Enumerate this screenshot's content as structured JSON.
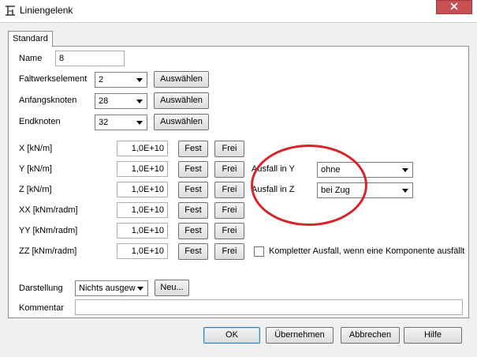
{
  "window": {
    "title": "Liniengelenk"
  },
  "tabs": [
    {
      "label": "Standard"
    }
  ],
  "fields": {
    "name": {
      "label": "Name",
      "value": "8"
    },
    "faltwerkselement": {
      "label": "Faltwerkselement",
      "value": "2",
      "button": "Auswählen"
    },
    "anfangsknoten": {
      "label": "Anfangsknoten",
      "value": "28",
      "button": "Auswählen"
    },
    "endknoten": {
      "label": "Endknoten",
      "value": "32",
      "button": "Auswählen"
    }
  },
  "springs": [
    {
      "label": "X [kN/m]",
      "value": "1,0E+10",
      "fest": "Fest",
      "frei": "Frei"
    },
    {
      "label": "Y [kN/m]",
      "value": "1,0E+10",
      "fest": "Fest",
      "frei": "Frei"
    },
    {
      "label": "Z [kN/m]",
      "value": "1,0E+10",
      "fest": "Fest",
      "frei": "Frei"
    },
    {
      "label": "XX [kNm/radm]",
      "value": "1,0E+10",
      "fest": "Fest",
      "frei": "Frei"
    },
    {
      "label": "YY [kNm/radm]",
      "value": "1,0E+10",
      "fest": "Fest",
      "frei": "Frei"
    },
    {
      "label": "ZZ [kNm/radm]",
      "value": "1,0E+10",
      "fest": "Fest",
      "frei": "Frei"
    }
  ],
  "ausfall": {
    "y": {
      "label": "Ausfall in Y",
      "value": "ohne"
    },
    "z": {
      "label": "Ausfall in Z",
      "value": "bei Zug"
    }
  },
  "komplett_checkbox": {
    "label": "Kompletter Ausfall, wenn eine Komponente ausfällt",
    "checked": false
  },
  "darstellung": {
    "label": "Darstellung",
    "value": "Nichts ausgew",
    "button": "Neu..."
  },
  "kommentar": {
    "label": "Kommentar",
    "value": ""
  },
  "footer": {
    "ok": "OK",
    "apply": "Übernehmen",
    "cancel": "Abbrechen",
    "help": "Hilfe"
  },
  "colors": {
    "annotation_circle": "#d8232a",
    "close_button": "#c75050"
  },
  "icons": {
    "app": "hinge-icon",
    "close": "close-icon",
    "dropdown": "chevron-down-icon"
  }
}
